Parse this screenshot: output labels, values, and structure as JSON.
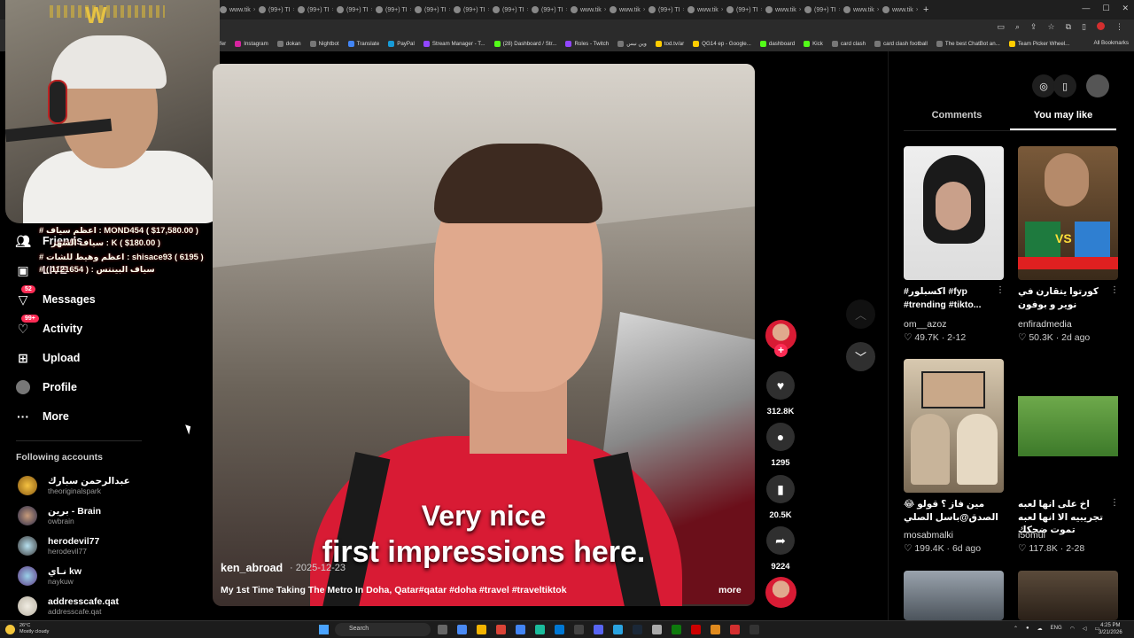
{
  "browser": {
    "tabs": [
      "www.tik",
      "(99+) TI",
      "(99+) TI",
      "(99+) TI",
      "(99+) TI",
      "(99+) TI",
      "(99+) TI",
      "(99+) TI",
      "(99+) TI",
      "www.tik",
      "www.tik",
      "(99+) TI",
      "www.tik",
      "(99+) TI",
      "www.tik",
      "(99+) TI",
      "www.tik",
      "www.tik"
    ],
    "new_tab": "+",
    "bookmarks": [
      "Instagram",
      "dokan",
      "Nightbot",
      "Translate",
      "PayPal",
      "Stream Manager - T...",
      "(28) Dashboard / Str...",
      "Roles - Twitch",
      "وين نبس",
      "tod.tv/ar",
      "QG14 ep - Google...",
      "dashboard",
      "Kick",
      "card clash",
      "card clash football",
      "The best ChatBot an...",
      "Team Picker Wheel..."
    ],
    "all_bookmarks": "All Bookmarks"
  },
  "overlay": {
    "line1": "# اعظم سياف : MOND454 ( $17,580.00 )",
    "line2": "سياف الشهر : K ( $180.00 )",
    "line3": "# اعظم وهيط للشات : shisace93 ( 6195 )",
    "line4": "# سياف البينتس : ( 1121654 )"
  },
  "nav": {
    "friends": "Friends",
    "live": "LIVE",
    "messages": "Messages",
    "messages_badge": "52",
    "activity": "Activity",
    "activity_badge": "99+",
    "upload": "Upload",
    "profile": "Profile",
    "more": "More"
  },
  "following": {
    "title": "Following accounts",
    "accounts": [
      {
        "name": "عبدالرحمن سبارك",
        "handle": "theoriginalspark"
      },
      {
        "name": "برين - Brain",
        "handle": "owbrain"
      },
      {
        "name": "herodevil77",
        "handle": "herodevil77"
      },
      {
        "name": "نـاي kw",
        "handle": "naykuw"
      },
      {
        "name": "addresscafe.qat",
        "handle": "addresscafe.qat"
      }
    ]
  },
  "video": {
    "caption_line1": "Very nice",
    "caption_line2": "first impressions here.",
    "author": "ken_abroad",
    "date": "· 2025-12-23",
    "description": "My 1st Time Taking The Metro In Doha, Qatar#qatar #doha #travel #traveltiktok",
    "more": "more"
  },
  "actions": {
    "follow": "+",
    "likes": "312.8K",
    "comments": "1295",
    "saves": "20.5K",
    "shares": "9224"
  },
  "right_panel": {
    "tab_comments": "Comments",
    "tab_you_may_like": "You may like",
    "cards": [
      {
        "title": "#اكسبلور #fyp #trending #tikto...",
        "author": "om__azoz",
        "likes": "49.7K",
        "date": "2-12"
      },
      {
        "title": "كورتوا يتقارن في نوير و بوفون",
        "author": "enfiradmedia",
        "likes": "50.3K",
        "date": "2d ago"
      },
      {
        "title": "😂 مين فاز ؟ قولو الصدق@باسل الصلي",
        "author": "mosabmalki",
        "likes": "199.4K",
        "date": "6d ago"
      },
      {
        "title": "اخ على انها لعبه تجريبيه الا انها لعبه تموت ضحكك",
        "author": "i5omul",
        "likes": "117.8K",
        "date": "2-28"
      }
    ]
  },
  "taskbar": {
    "temp": "26°C",
    "weather": "Mostly cloudy",
    "search": "Search",
    "lang": "ENG",
    "time": "4:25 PM",
    "date": "3/21/2026"
  },
  "colors": {
    "accent": "#fe2c55",
    "background": "#000000",
    "panel": "#2f2f2f"
  }
}
